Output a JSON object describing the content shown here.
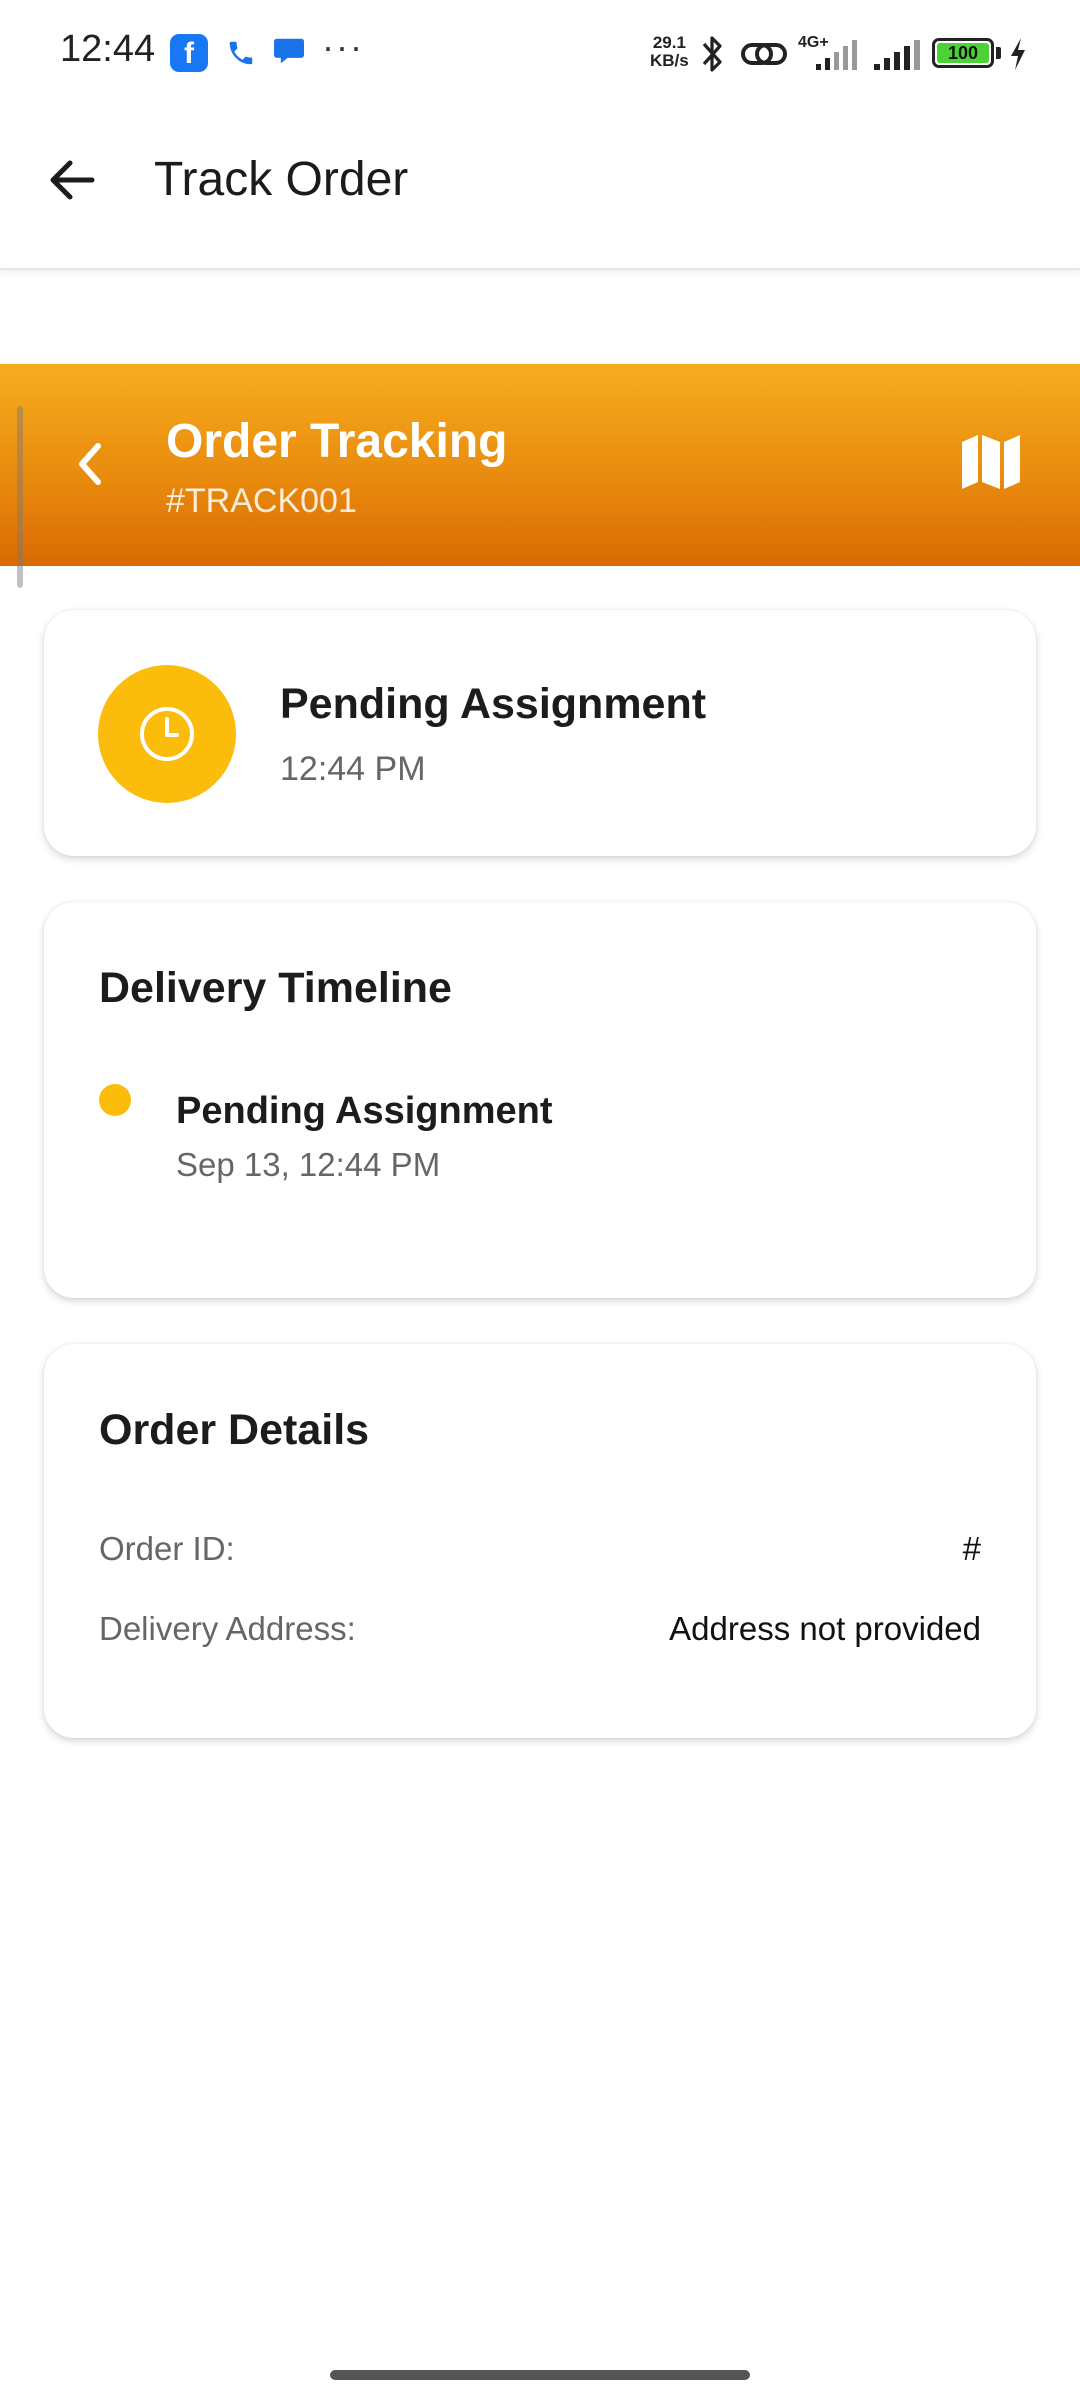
{
  "status_bar": {
    "time": "12:44",
    "fb_letter": "f",
    "more": "···",
    "speed_value": "29.1",
    "speed_unit": "KB/s",
    "network": "4G+",
    "battery": "100",
    "icons": [
      "facebook-icon",
      "phone-icon",
      "message-icon",
      "bluetooth-icon",
      "link-icon",
      "signal-icon",
      "battery-icon",
      "charging-icon"
    ]
  },
  "app_bar": {
    "title": "Track Order",
    "back_icon": "arrow-left-icon"
  },
  "order_header": {
    "title": "Order Tracking",
    "tracking_id": "#TRACK001",
    "back_icon": "chevron-left-icon",
    "map_icon": "map-icon"
  },
  "status_card": {
    "title": "Pending Assignment",
    "time": "12:44 PM",
    "icon": "clock-icon"
  },
  "timeline": {
    "title": "Delivery Timeline",
    "items": [
      {
        "title": "Pending Assignment",
        "time": "Sep 13, 12:44 PM"
      }
    ]
  },
  "order_details": {
    "title": "Order Details",
    "rows": [
      {
        "label": "Order ID:",
        "value": "#"
      },
      {
        "label": "Delivery Address:",
        "value": "Address not provided"
      }
    ]
  },
  "colors": {
    "header_top": "#f6ac1f",
    "header_bottom": "#d96a03",
    "status_yellow": "#fbbc0b"
  }
}
